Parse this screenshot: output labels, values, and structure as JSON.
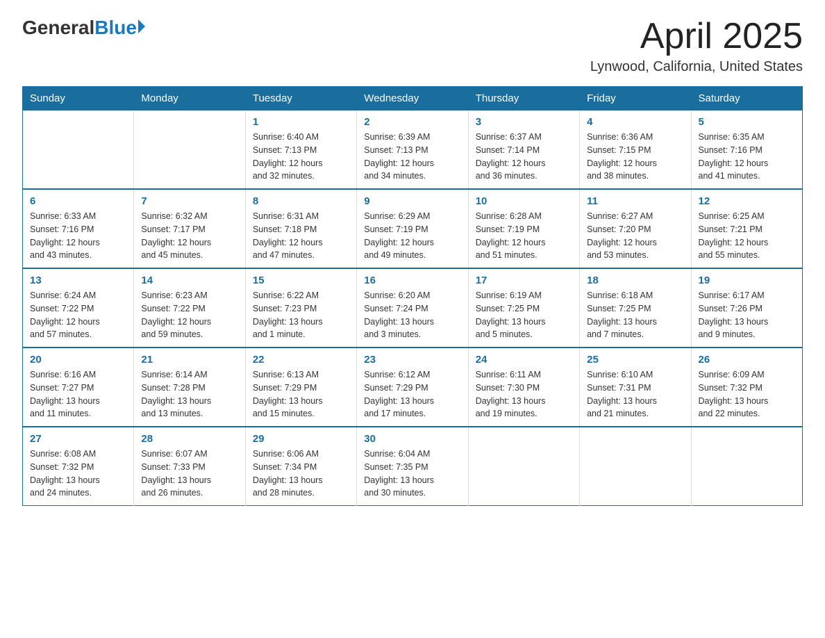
{
  "logo": {
    "general": "General",
    "blue": "Blue"
  },
  "header": {
    "title": "April 2025",
    "subtitle": "Lynwood, California, United States"
  },
  "weekdays": [
    "Sunday",
    "Monday",
    "Tuesday",
    "Wednesday",
    "Thursday",
    "Friday",
    "Saturday"
  ],
  "weeks": [
    [
      {
        "day": "",
        "info": ""
      },
      {
        "day": "",
        "info": ""
      },
      {
        "day": "1",
        "info": "Sunrise: 6:40 AM\nSunset: 7:13 PM\nDaylight: 12 hours\nand 32 minutes."
      },
      {
        "day": "2",
        "info": "Sunrise: 6:39 AM\nSunset: 7:13 PM\nDaylight: 12 hours\nand 34 minutes."
      },
      {
        "day": "3",
        "info": "Sunrise: 6:37 AM\nSunset: 7:14 PM\nDaylight: 12 hours\nand 36 minutes."
      },
      {
        "day": "4",
        "info": "Sunrise: 6:36 AM\nSunset: 7:15 PM\nDaylight: 12 hours\nand 38 minutes."
      },
      {
        "day": "5",
        "info": "Sunrise: 6:35 AM\nSunset: 7:16 PM\nDaylight: 12 hours\nand 41 minutes."
      }
    ],
    [
      {
        "day": "6",
        "info": "Sunrise: 6:33 AM\nSunset: 7:16 PM\nDaylight: 12 hours\nand 43 minutes."
      },
      {
        "day": "7",
        "info": "Sunrise: 6:32 AM\nSunset: 7:17 PM\nDaylight: 12 hours\nand 45 minutes."
      },
      {
        "day": "8",
        "info": "Sunrise: 6:31 AM\nSunset: 7:18 PM\nDaylight: 12 hours\nand 47 minutes."
      },
      {
        "day": "9",
        "info": "Sunrise: 6:29 AM\nSunset: 7:19 PM\nDaylight: 12 hours\nand 49 minutes."
      },
      {
        "day": "10",
        "info": "Sunrise: 6:28 AM\nSunset: 7:19 PM\nDaylight: 12 hours\nand 51 minutes."
      },
      {
        "day": "11",
        "info": "Sunrise: 6:27 AM\nSunset: 7:20 PM\nDaylight: 12 hours\nand 53 minutes."
      },
      {
        "day": "12",
        "info": "Sunrise: 6:25 AM\nSunset: 7:21 PM\nDaylight: 12 hours\nand 55 minutes."
      }
    ],
    [
      {
        "day": "13",
        "info": "Sunrise: 6:24 AM\nSunset: 7:22 PM\nDaylight: 12 hours\nand 57 minutes."
      },
      {
        "day": "14",
        "info": "Sunrise: 6:23 AM\nSunset: 7:22 PM\nDaylight: 12 hours\nand 59 minutes."
      },
      {
        "day": "15",
        "info": "Sunrise: 6:22 AM\nSunset: 7:23 PM\nDaylight: 13 hours\nand 1 minute."
      },
      {
        "day": "16",
        "info": "Sunrise: 6:20 AM\nSunset: 7:24 PM\nDaylight: 13 hours\nand 3 minutes."
      },
      {
        "day": "17",
        "info": "Sunrise: 6:19 AM\nSunset: 7:25 PM\nDaylight: 13 hours\nand 5 minutes."
      },
      {
        "day": "18",
        "info": "Sunrise: 6:18 AM\nSunset: 7:25 PM\nDaylight: 13 hours\nand 7 minutes."
      },
      {
        "day": "19",
        "info": "Sunrise: 6:17 AM\nSunset: 7:26 PM\nDaylight: 13 hours\nand 9 minutes."
      }
    ],
    [
      {
        "day": "20",
        "info": "Sunrise: 6:16 AM\nSunset: 7:27 PM\nDaylight: 13 hours\nand 11 minutes."
      },
      {
        "day": "21",
        "info": "Sunrise: 6:14 AM\nSunset: 7:28 PM\nDaylight: 13 hours\nand 13 minutes."
      },
      {
        "day": "22",
        "info": "Sunrise: 6:13 AM\nSunset: 7:29 PM\nDaylight: 13 hours\nand 15 minutes."
      },
      {
        "day": "23",
        "info": "Sunrise: 6:12 AM\nSunset: 7:29 PM\nDaylight: 13 hours\nand 17 minutes."
      },
      {
        "day": "24",
        "info": "Sunrise: 6:11 AM\nSunset: 7:30 PM\nDaylight: 13 hours\nand 19 minutes."
      },
      {
        "day": "25",
        "info": "Sunrise: 6:10 AM\nSunset: 7:31 PM\nDaylight: 13 hours\nand 21 minutes."
      },
      {
        "day": "26",
        "info": "Sunrise: 6:09 AM\nSunset: 7:32 PM\nDaylight: 13 hours\nand 22 minutes."
      }
    ],
    [
      {
        "day": "27",
        "info": "Sunrise: 6:08 AM\nSunset: 7:32 PM\nDaylight: 13 hours\nand 24 minutes."
      },
      {
        "day": "28",
        "info": "Sunrise: 6:07 AM\nSunset: 7:33 PM\nDaylight: 13 hours\nand 26 minutes."
      },
      {
        "day": "29",
        "info": "Sunrise: 6:06 AM\nSunset: 7:34 PM\nDaylight: 13 hours\nand 28 minutes."
      },
      {
        "day": "30",
        "info": "Sunrise: 6:04 AM\nSunset: 7:35 PM\nDaylight: 13 hours\nand 30 minutes."
      },
      {
        "day": "",
        "info": ""
      },
      {
        "day": "",
        "info": ""
      },
      {
        "day": "",
        "info": ""
      }
    ]
  ]
}
